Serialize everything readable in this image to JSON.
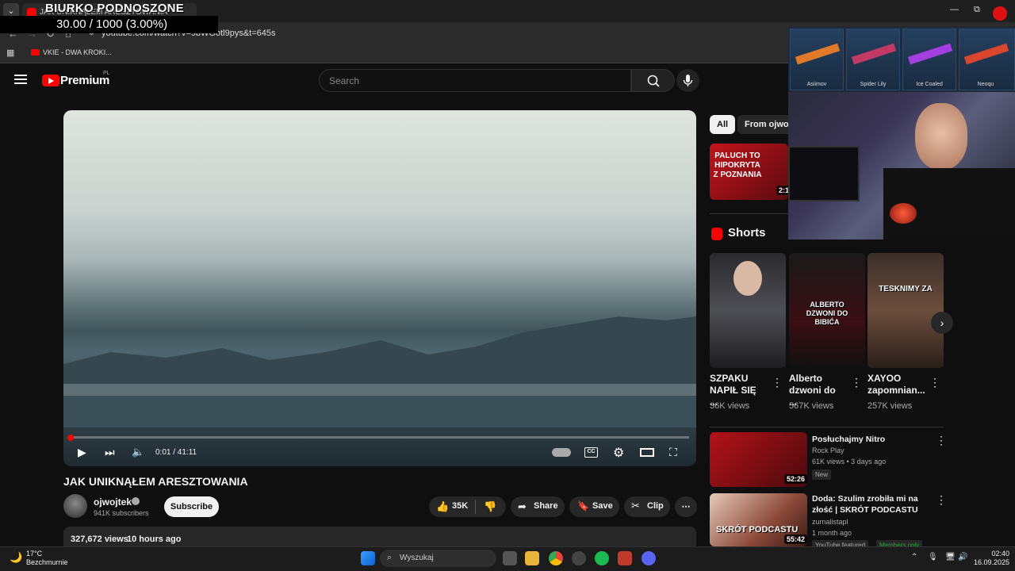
{
  "overlay": {
    "title": "BIURKO PODNOSZONE",
    "counter": "30.00 / 1000 (3.00%)"
  },
  "browser": {
    "tab_title": "JAK UNIKNĄŁEM ARESZTOWANIA",
    "url": "youtube.com/watch?v=9bWGotl9pys&t=645s",
    "bookmark_label": "VKIE - DWA KROKI...",
    "window_buttons": [
      "—",
      "⧉",
      "✕"
    ]
  },
  "youtube": {
    "brand": "Premium",
    "region": "PL",
    "search_placeholder": "Search"
  },
  "player": {
    "time": "0:01 / 41:11",
    "progress": 0.0004
  },
  "video": {
    "title": "JAK UNIKNĄŁEM ARESZTOWANIA",
    "channel": "ojwojtek",
    "subscribers": "941K subscribers",
    "subscribe_label": "Subscribe",
    "likes": "35K",
    "share_label": "Share",
    "save_label": "Save",
    "clip_label": "Clip",
    "views": "327,672 views",
    "posted": "10 hours ago"
  },
  "chips": [
    "All",
    "From ojwojt"
  ],
  "top_rec": {
    "thumb_text": "PALUCH TO HIPOKRYTA Z POZNANIA",
    "duration": "2:1"
  },
  "shorts": {
    "heading": "Shorts",
    "items": [
      {
        "title": "SZPAKU NAPIŁ SIĘ ...",
        "views": "36K views",
        "overlay": ""
      },
      {
        "title": "Alberto dzwoni do ...",
        "views": "567K views",
        "overlay": "ALBERTO DZWONI DO BIBIĆA"
      },
      {
        "title": "XAYOO zapomnian...",
        "views": "257K views",
        "overlay": "TESKNIMY ZA"
      }
    ]
  },
  "recommendations": [
    {
      "title": "Posłuchajmy Nitro",
      "channel": "Rock Play",
      "meta": "61K views • 3 days ago",
      "badge": "New",
      "duration": "52:26"
    },
    {
      "title": "Doda: Szulim zrobiła mi na złość | SKRÓT PODCASTU",
      "channel": "zurnalistapl",
      "meta": "1 month ago",
      "badge": "YouTube featured",
      "badge2": "Members only",
      "duration": "55:42",
      "thumb_text": "SKRÓT PODCASTU"
    }
  ],
  "skins": [
    "Asiimov",
    "Spider Lily",
    "Ice Coaled",
    "Neoqu"
  ],
  "taskbar": {
    "temperature": "17°C",
    "weather": "Bezchmurnie",
    "search": "Wyszukaj",
    "time": "02:40",
    "date": "16.09.2025"
  },
  "colors": {
    "accent": "#ff0000",
    "background": "#0f0f0f",
    "surface": "#272727"
  }
}
